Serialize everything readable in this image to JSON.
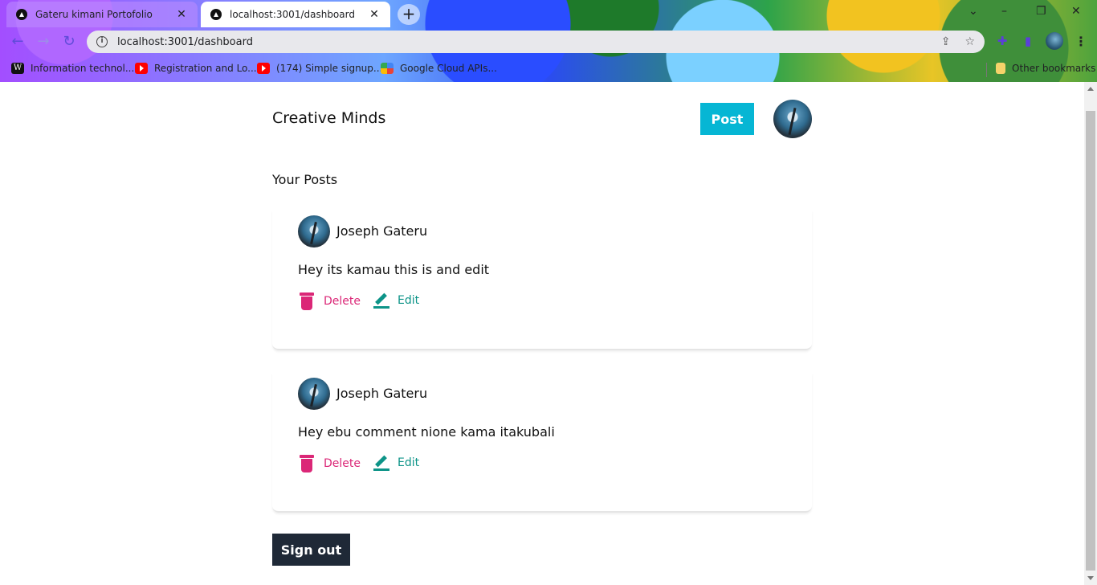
{
  "browser": {
    "tabs": [
      {
        "title": "Gateru kimani Portofolio",
        "active": false
      },
      {
        "title": "localhost:3001/dashboard",
        "active": true
      }
    ],
    "address": "localhost:3001/dashboard",
    "bookmarks": [
      {
        "label": "Information technol...",
        "icon": "wikipedia-icon"
      },
      {
        "label": "Registration and Lo...",
        "icon": "youtube-icon"
      },
      {
        "label": "(174) Simple signup...",
        "icon": "youtube-icon"
      },
      {
        "label": "Google Cloud APIs...",
        "icon": "google-cloud-icon"
      }
    ],
    "other_bookmarks": "Other bookmarks"
  },
  "header": {
    "brand": "Creative Minds",
    "post_label": "Post"
  },
  "dashboard": {
    "title": "Your Posts",
    "posts": [
      {
        "author": "Joseph Gateru",
        "content": "Hey its kamau this is and edit",
        "delete_label": "Delete",
        "edit_label": "Edit"
      },
      {
        "author": "Joseph Gateru",
        "content": "Hey ebu comment nione kama itakubali",
        "delete_label": "Delete",
        "edit_label": "Edit"
      }
    ],
    "signout_label": "Sign out"
  },
  "colors": {
    "post_button": "#06b6d4",
    "delete": "#db2777",
    "edit": "#0d9488",
    "signout_button": "#1f2937"
  }
}
